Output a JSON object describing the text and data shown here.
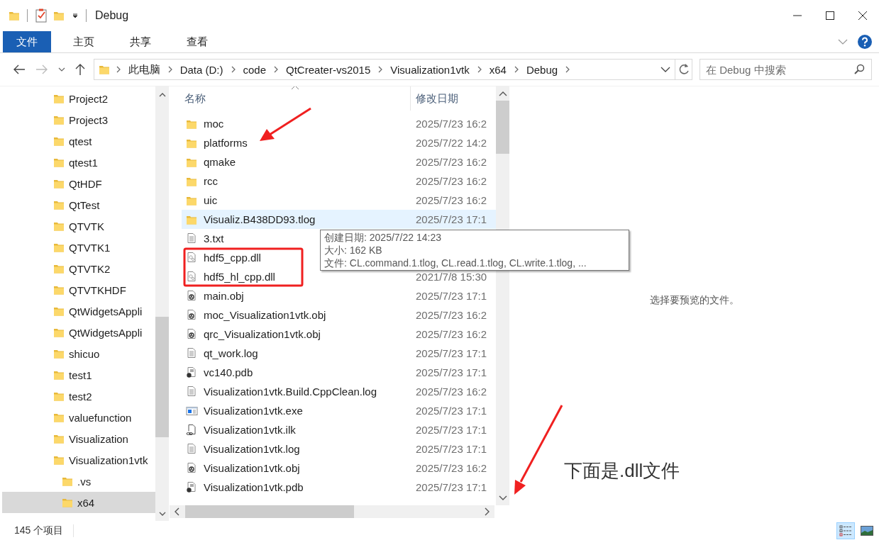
{
  "window": {
    "title": "Debug"
  },
  "ribbon_tabs": [
    {
      "label": "文件",
      "selected": true
    },
    {
      "label": "主页",
      "selected": false
    },
    {
      "label": "共享",
      "selected": false
    },
    {
      "label": "查看",
      "selected": false
    }
  ],
  "address": {
    "breadcrumbs": [
      "此电脑",
      "Data (D:)",
      "code",
      "QtCreater-vs2015",
      "Visualization1vtk",
      "x64",
      "Debug"
    ]
  },
  "search": {
    "placeholder": "在 Debug 中搜索"
  },
  "nav_tree": [
    {
      "label": "Project2",
      "selected": false
    },
    {
      "label": "Project3",
      "selected": false
    },
    {
      "label": "qtest",
      "selected": false
    },
    {
      "label": "qtest1",
      "selected": false
    },
    {
      "label": "QtHDF",
      "selected": false
    },
    {
      "label": "QtTest",
      "selected": false
    },
    {
      "label": "QTVTK",
      "selected": false
    },
    {
      "label": "QTVTK1",
      "selected": false
    },
    {
      "label": "QTVTK2",
      "selected": false
    },
    {
      "label": "QTVTKHDF",
      "selected": false
    },
    {
      "label": "QtWidgetsAppli",
      "selected": false
    },
    {
      "label": "QtWidgetsAppli",
      "selected": false
    },
    {
      "label": "shicuo",
      "selected": false
    },
    {
      "label": "test1",
      "selected": false
    },
    {
      "label": "test2",
      "selected": false
    },
    {
      "label": "valuefunction",
      "selected": false
    },
    {
      "label": "Visualization",
      "selected": false
    },
    {
      "label": "Visualization1vtk",
      "selected": false,
      "children": [
        {
          "label": ".vs",
          "selected": false
        },
        {
          "label": "x64",
          "selected": true
        }
      ]
    }
  ],
  "file_list": {
    "columns": [
      "名称",
      "修改日期"
    ],
    "rows": [
      {
        "name": "moc",
        "kind": "folder",
        "modified": "2025/7/23 16:2",
        "highlighted": false
      },
      {
        "name": "platforms",
        "kind": "folder",
        "modified": "2025/7/22 14:2",
        "highlighted": false
      },
      {
        "name": "qmake",
        "kind": "folder",
        "modified": "2025/7/23 16:2",
        "highlighted": false
      },
      {
        "name": "rcc",
        "kind": "folder",
        "modified": "2025/7/23 16:2",
        "highlighted": false
      },
      {
        "name": "uic",
        "kind": "folder",
        "modified": "2025/7/23 16:2",
        "highlighted": false
      },
      {
        "name": "Visualiz.B438DD93.tlog",
        "kind": "folder",
        "modified": "2025/7/23 17:1",
        "highlighted": true
      },
      {
        "name": "3.txt",
        "kind": "text",
        "highlighted": false
      },
      {
        "name": "hdf5_cpp.dll",
        "kind": "dll",
        "highlighted": false
      },
      {
        "name": "hdf5_hl_cpp.dll",
        "kind": "dll",
        "modified": "2021/7/8 15:30",
        "highlighted": false
      },
      {
        "name": "main.obj",
        "kind": "obj",
        "modified": "2025/7/23 17:1",
        "highlighted": false
      },
      {
        "name": "moc_Visualization1vtk.obj",
        "kind": "obj",
        "modified": "2025/7/23 16:2",
        "highlighted": false
      },
      {
        "name": "qrc_Visualization1vtk.obj",
        "kind": "obj",
        "modified": "2025/7/23 16:2",
        "highlighted": false
      },
      {
        "name": "qt_work.log",
        "kind": "text",
        "modified": "2025/7/23 17:1",
        "highlighted": false
      },
      {
        "name": "vc140.pdb",
        "kind": "pdb",
        "modified": "2025/7/23 17:1",
        "highlighted": false
      },
      {
        "name": "Visualization1vtk.Build.CppClean.log",
        "kind": "text",
        "modified": "2025/7/23 16:2",
        "highlighted": false
      },
      {
        "name": "Visualization1vtk.exe",
        "kind": "exe",
        "modified": "2025/7/23 17:1",
        "highlighted": false
      },
      {
        "name": "Visualization1vtk.ilk",
        "kind": "ilk",
        "modified": "2025/7/23 17:1",
        "highlighted": false
      },
      {
        "name": "Visualization1vtk.log",
        "kind": "text",
        "modified": "2025/7/23 17:1",
        "highlighted": false
      },
      {
        "name": "Visualization1vtk.obj",
        "kind": "obj",
        "modified": "2025/7/23 16:2",
        "highlighted": false
      },
      {
        "name": "Visualization1vtk.pdb",
        "kind": "pdb",
        "modified": "2025/7/23 17:1",
        "highlighted": false
      }
    ]
  },
  "tooltip": {
    "lines": [
      "创建日期: 2025/7/22 14:23",
      "大小: 162 KB",
      "文件: CL.command.1.tlog, CL.read.1.tlog, CL.write.1.tlog, ..."
    ]
  },
  "preview": {
    "message": "选择要预览的文件。"
  },
  "status_bar": {
    "item_count": "145 个项目",
    "views": [
      {
        "kind": "details",
        "selected": true
      },
      {
        "kind": "preview",
        "selected": false
      }
    ]
  },
  "annotation": {
    "note": "下面是.dll文件"
  }
}
